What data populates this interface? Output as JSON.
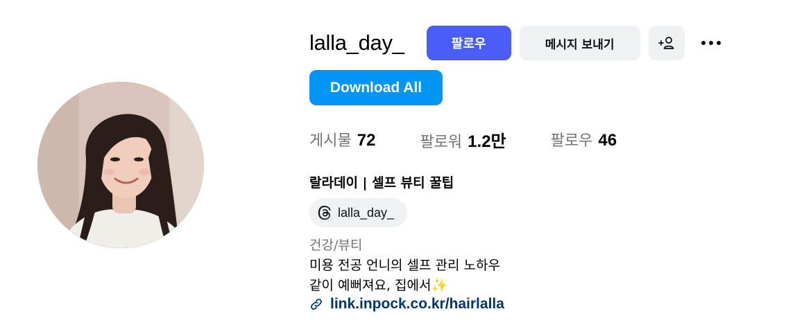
{
  "profile": {
    "username": "lalla_day_",
    "full_name": "랄라데이 | 셀프 뷰티 꿀팁",
    "threads_handle": "lalla_day_",
    "category": "건강/뷰티",
    "bio_line1": "미용 전공 언니의 셀프 관리 노하우",
    "bio_line2": "같이 예뻐져요, 집에서",
    "bio_emoji": "✨",
    "link": "link.inpock.co.kr/hairlalla"
  },
  "actions": {
    "follow_label": "팔로우",
    "message_label": "메시지 보내기",
    "add_user_icon": "person-add-icon",
    "more_icon": "more-horizontal-icon",
    "download_label": "Download All"
  },
  "stats": {
    "posts_label": "게시물",
    "posts_value": "72",
    "followers_label": "팔로워",
    "followers_value": "1.2만",
    "following_label": "팔로우",
    "following_value": "46"
  },
  "colors": {
    "follow_button": "#4a5df9",
    "download_button": "#0095f6",
    "secondary_button": "#eff1f5",
    "link": "#00376b",
    "muted_text": "#737373"
  }
}
